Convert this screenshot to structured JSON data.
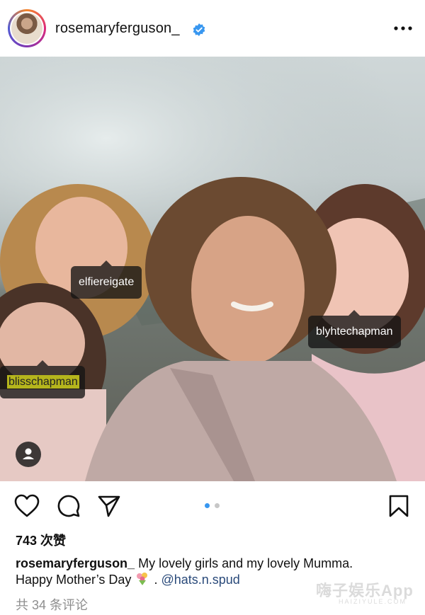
{
  "header": {
    "username": "rosemaryferguson_",
    "verified_color": "#3897f0",
    "more_icon": "more-horizontal-icon"
  },
  "post": {
    "tags": [
      {
        "name": "elfiereigate"
      },
      {
        "name": "blyhtechapman"
      },
      {
        "name": "blisschapman"
      }
    ],
    "user_badge_icon": "person-icon",
    "carousel": {
      "total": 2,
      "active": 1,
      "active_color": "#3897f0",
      "inactive_color": "#c7c7c7"
    }
  },
  "actions": {
    "like_icon": "heart-icon",
    "comment_icon": "comment-icon",
    "share_icon": "send-icon",
    "save_icon": "bookmark-icon"
  },
  "likes": "743 次赞",
  "caption": {
    "username": "rosemaryferguson_",
    "text_line1": "My lovely girls and my lovely Mumma.",
    "text_line2": "Happy Mother’s Day",
    "separator": ".",
    "mention": "@hats.n.spud"
  },
  "comments_link": "共 34 条评论",
  "watermark": {
    "main": "嗨子娱乐App",
    "sub": "HAIZIYULE.COM"
  }
}
